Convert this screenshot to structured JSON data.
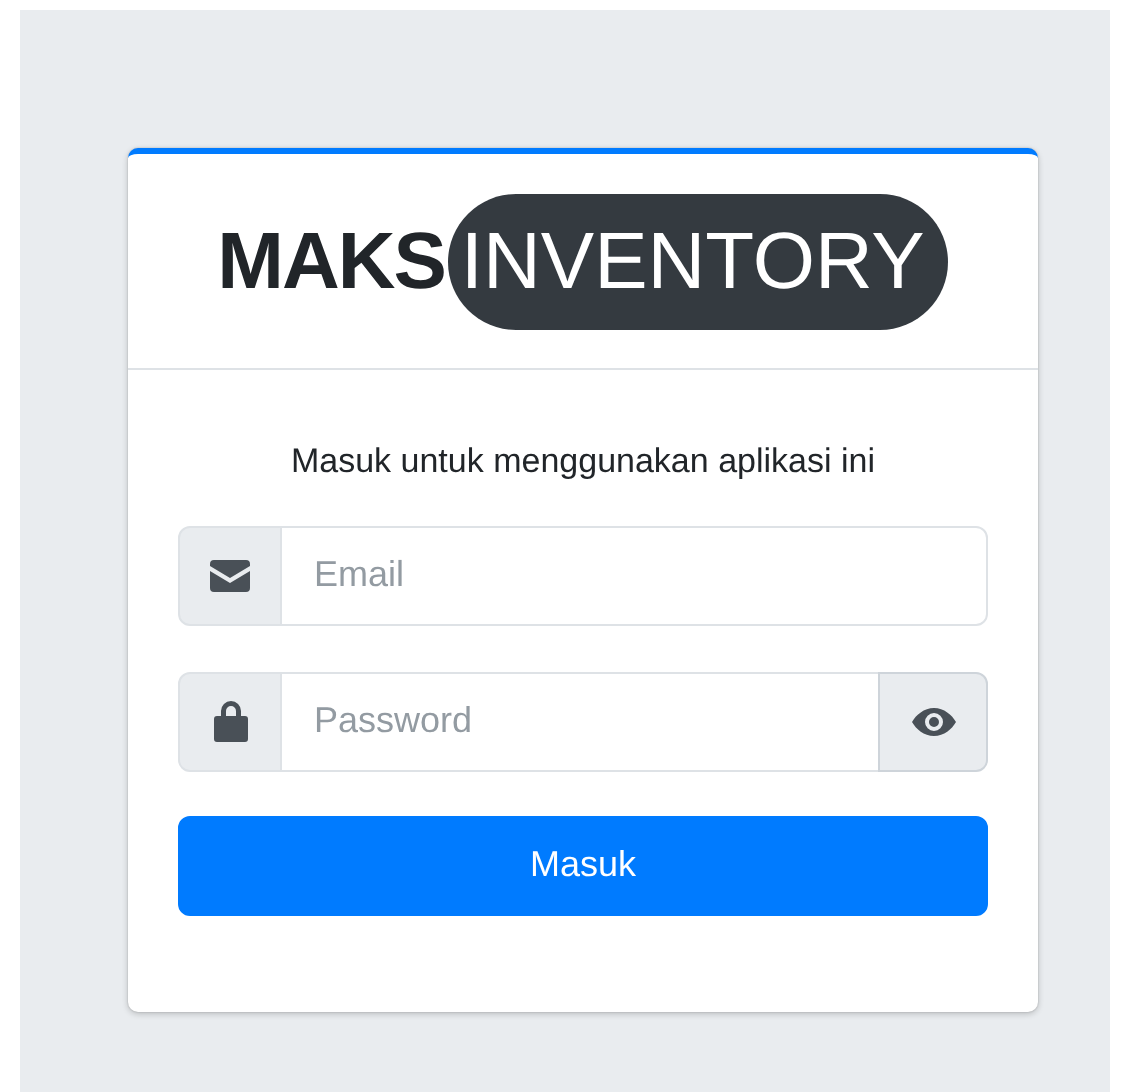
{
  "brand": {
    "bold": "MAKS",
    "pill": "INVENTORY"
  },
  "message": "Masuk untuk menggunakan aplikasi ini",
  "fields": [
    {
      "kind": "email",
      "placeholder": "Email"
    },
    {
      "kind": "password",
      "placeholder": "Password"
    }
  ],
  "submit": "Masuk"
}
